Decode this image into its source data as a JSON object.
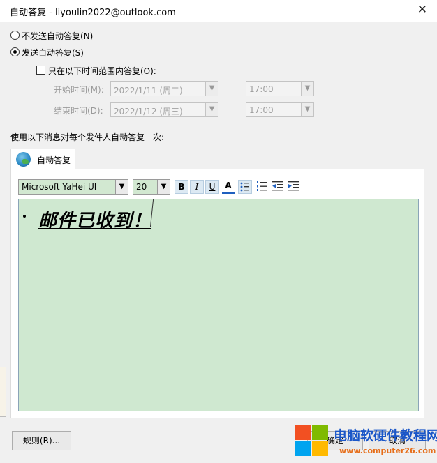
{
  "window": {
    "title": "自动答复 - liyoulin2022@outlook.com",
    "close_glyph": "✕"
  },
  "options": {
    "no_reply": "不发送自动答复(N)",
    "send_reply": "发送自动答复(S)",
    "send_reply_checked": true,
    "time_range_only": "只在以下时间范围内答复(O):",
    "time_range_checked": false
  },
  "schedule": {
    "start_label": "开始时间(M):",
    "start_date": "2022/1/11 (周二)",
    "start_time": "17:00",
    "end_label": "结束时间(D):",
    "end_date": "2022/1/12 (周三)",
    "end_time": "17:00"
  },
  "instruction": "使用以下消息对每个发件人自动答复一次:",
  "tab": {
    "label": "自动答复",
    "icon": "globe-envelope-icon"
  },
  "toolbar": {
    "font": "Microsoft YaHei UI",
    "size": "20",
    "bold": "B",
    "italic": "I",
    "underline": "U",
    "font_color": "A",
    "font_color_value": "#1f5fbf"
  },
  "editor": {
    "message": "邮件已收到！"
  },
  "buttons": {
    "rules": "规则(R)...",
    "ok": "确定",
    "cancel": "取消"
  },
  "watermark": {
    "title": "电脑软硬件教程网",
    "url": "www.computer26.com"
  },
  "colors": {
    "editor_bg": "#cfe8d0",
    "watermark_title": "#1a56c8",
    "watermark_url": "#e66e1a"
  }
}
